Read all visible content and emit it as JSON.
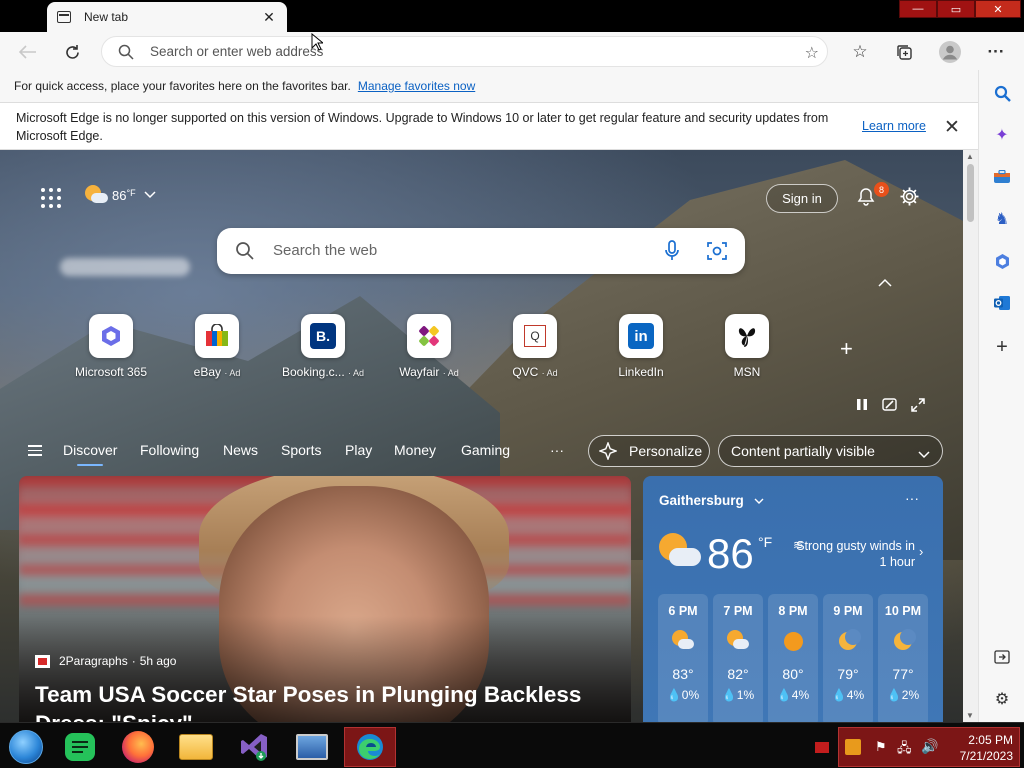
{
  "browser": {
    "tab_title": "New tab",
    "address_placeholder": "Search or enter web address",
    "window_controls": [
      "—",
      "▭",
      "✕"
    ]
  },
  "favorites_bar": {
    "text": "For quick access, place your favorites here on the favorites bar.",
    "link": "Manage favorites now"
  },
  "notice": {
    "text": "Microsoft Edge is no longer supported on this version of Windows. Upgrade to Windows 10 or later to get regular feature and security updates from Microsoft Edge.",
    "link": "Learn more"
  },
  "newtab": {
    "weather_temp": "86",
    "weather_unit": "°F",
    "sign_in": "Sign in",
    "notifications_count": "8",
    "search_placeholder": "Search the web",
    "quick_links": [
      {
        "label": "Microsoft 365",
        "ad": ""
      },
      {
        "label": "eBay",
        "ad": "· Ad"
      },
      {
        "label": "Booking.c...",
        "ad": "· Ad"
      },
      {
        "label": "Wayfair",
        "ad": "· Ad"
      },
      {
        "label": "QVC",
        "ad": "· Ad"
      },
      {
        "label": "LinkedIn",
        "ad": ""
      },
      {
        "label": "MSN",
        "ad": ""
      }
    ]
  },
  "feed_nav": {
    "items": [
      "Discover",
      "Following",
      "News",
      "Sports",
      "Play",
      "Money",
      "Gaming"
    ],
    "more": "···",
    "personalize": "Personalize",
    "content_visibility": "Content partially visible"
  },
  "hero_article": {
    "source": "2Paragraphs",
    "age": "5h ago",
    "headline": "Team USA Soccer Star Poses in Plunging Backless Dress: \"Spicy\""
  },
  "weather_card": {
    "city": "Gaithersburg",
    "temp": "86",
    "unit": "°F",
    "alert": "Strong gusty winds in 1 hour",
    "hourly": [
      {
        "time": "6 PM",
        "icon": "partly-sunny-icon",
        "temp": "83°",
        "precip": "0%"
      },
      {
        "time": "7 PM",
        "icon": "partly-sunny-icon",
        "temp": "82°",
        "precip": "1%"
      },
      {
        "time": "8 PM",
        "icon": "sun-icon",
        "temp": "80°",
        "precip": "4%"
      },
      {
        "time": "9 PM",
        "icon": "moon-icon",
        "temp": "79°",
        "precip": "4%"
      },
      {
        "time": "10 PM",
        "icon": "moon-icon",
        "temp": "77°",
        "precip": "2%"
      }
    ]
  },
  "taskbar": {
    "time": "2:05 PM",
    "date": "7/21/2023"
  },
  "colors": {
    "accent": "#0b61c3",
    "weather_card": "#3a6fae",
    "taskbar_active": "#7c1616"
  }
}
